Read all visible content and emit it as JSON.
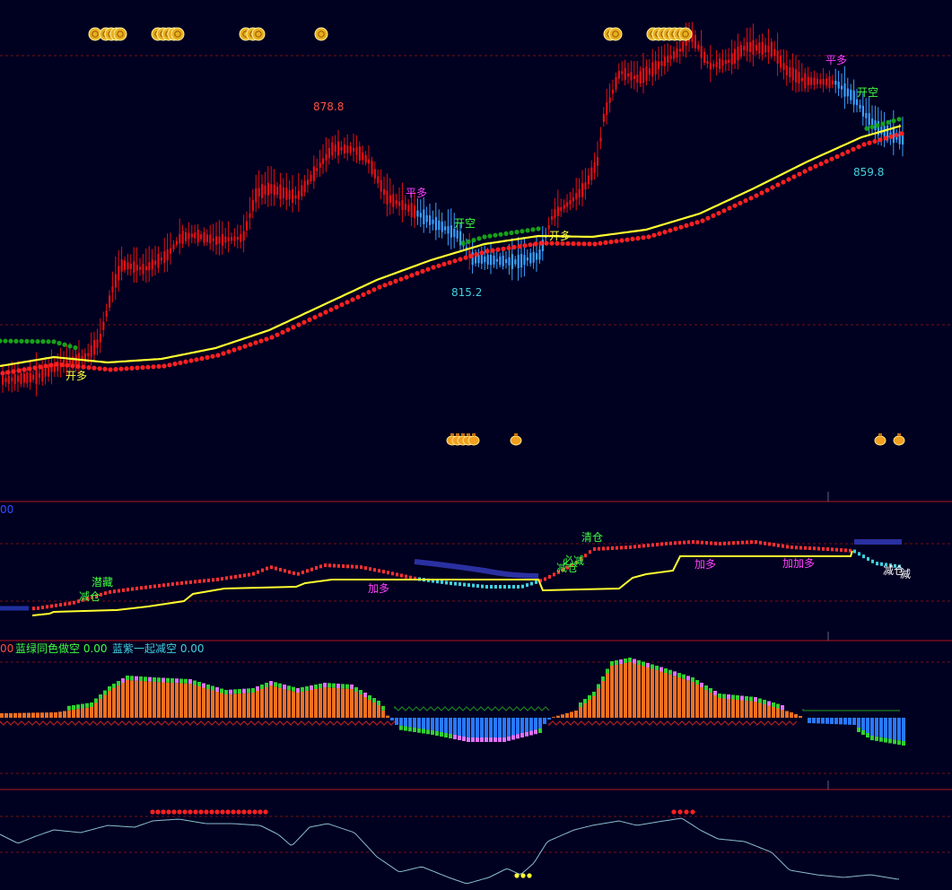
{
  "colors": {
    "background": "#000020",
    "up_candle": "#e01010",
    "down_candle": "#3aa0ff",
    "ma_line": "#ffff30",
    "red_dots": "#ff2020",
    "green_dots": "#18a018",
    "grid": "#7a1010",
    "divider": "#b01818",
    "histogram_orange": "#f07020",
    "histogram_blue": "#2878ff",
    "histogram_green": "#30d030",
    "histogram_violet": "#e070ff",
    "oscillator_line": "#8abcd0",
    "label_yellow": "#ffff40",
    "label_green": "#40ff40",
    "label_magenta": "#ff40ff",
    "label_cyan": "#40d0e0",
    "label_red": "#ff5040"
  },
  "icons": {
    "coin_top": "gold-coin-icon",
    "money_bag": "money-bag-icon"
  },
  "main_panel": {
    "price_labels": {
      "high": "878.8",
      "low_mid": "815.2",
      "last_low": "859.8"
    },
    "signals": {
      "open_long_1": "开多",
      "close_long_1": "平多",
      "open_short_1": "开空",
      "open_long_2": "开多",
      "close_long_2": "平多",
      "open_short_2": "开空"
    }
  },
  "sub_panel_1": {
    "header_value": "00",
    "labels": {
      "hide": "潜藏",
      "reduce_a": "减仓",
      "add_long_a": "加多",
      "clear": "清仓",
      "must_reduce": "必减",
      "reduce_b": "减仓",
      "add_long_b": "加多",
      "add_more": "加加多",
      "reduce_c": "减仓",
      "reduce_d": "减"
    }
  },
  "sub_panel_2": {
    "header_lead": "00",
    "item_1": "蓝绿同色做空 0.00",
    "item_2": "蓝紫一起减空 0.00"
  },
  "chart_data": {
    "type": "candlestick",
    "price_extremes": {
      "high": 878.8,
      "low": 815.2,
      "last_marked": 859.8
    },
    "panels": [
      "price with moving average",
      "position signal line",
      "histogram oscillator",
      "oscillator line"
    ]
  }
}
